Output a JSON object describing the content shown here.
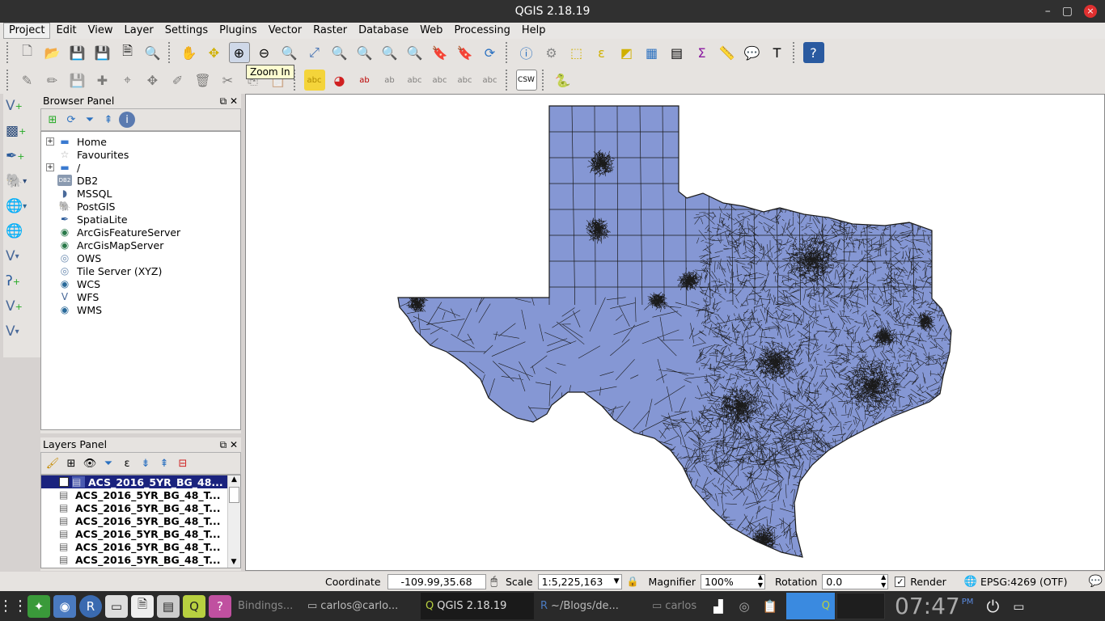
{
  "window": {
    "title": "QGIS 2.18.19",
    "min": "–",
    "max": "▢",
    "close": "×"
  },
  "menu": [
    "Project",
    "Edit",
    "View",
    "Layer",
    "Settings",
    "Plugins",
    "Vector",
    "Raster",
    "Database",
    "Web",
    "Processing",
    "Help"
  ],
  "tooltip": "Zoom In",
  "browser": {
    "title": "Browser Panel",
    "items": [
      {
        "label": "Home",
        "icon": "folder-icon",
        "expand": true
      },
      {
        "label": "Favourites",
        "icon": "star-icon",
        "expand": false
      },
      {
        "label": "/",
        "icon": "folder-icon",
        "expand": true
      },
      {
        "label": "DB2",
        "icon": "db2-icon",
        "expand": false
      },
      {
        "label": "MSSQL",
        "icon": "mssql-icon",
        "expand": false
      },
      {
        "label": "PostGIS",
        "icon": "postgis-icon",
        "expand": false
      },
      {
        "label": "SpatiaLite",
        "icon": "spatialite-icon",
        "expand": false
      },
      {
        "label": "ArcGisFeatureServer",
        "icon": "arcgis-icon",
        "expand": false
      },
      {
        "label": "ArcGisMapServer",
        "icon": "arcgis-icon",
        "expand": false
      },
      {
        "label": "OWS",
        "icon": "globe-icon",
        "expand": false
      },
      {
        "label": "Tile Server (XYZ)",
        "icon": "tile-icon",
        "expand": false
      },
      {
        "label": "WCS",
        "icon": "wcs-icon",
        "expand": false
      },
      {
        "label": "WFS",
        "icon": "wfs-icon",
        "expand": false
      },
      {
        "label": "WMS",
        "icon": "wms-icon",
        "expand": false
      }
    ]
  },
  "layers": {
    "title": "Layers Panel",
    "items": [
      {
        "label": "ACS_2016_5YR_BG_48...",
        "selected": true
      },
      {
        "label": "ACS_2016_5YR_BG_48_T...",
        "selected": false
      },
      {
        "label": "ACS_2016_5YR_BG_48_T...",
        "selected": false
      },
      {
        "label": "ACS_2016_5YR_BG_48_T...",
        "selected": false
      },
      {
        "label": "ACS_2016_5YR_BG_48_T...",
        "selected": false
      },
      {
        "label": "ACS_2016_5YR_BG_48_T...",
        "selected": false
      },
      {
        "label": "ACS_2016_5YR_BG_48_T...",
        "selected": false
      }
    ]
  },
  "map": {
    "fill": "#8597d4",
    "stroke": "#1a1a1a"
  },
  "status": {
    "coordinate_label": "Coordinate",
    "coordinate": "-109.99,35.68",
    "scale_label": "Scale",
    "scale": "1:5,225,163",
    "magnifier_label": "Magnifier",
    "magnifier": "100%",
    "rotation_label": "Rotation",
    "rotation": "0.0",
    "render_label": "Render",
    "crs": "EPSG:4269 (OTF)"
  },
  "taskbar": {
    "tasks": [
      "Bindings...",
      "carlos@carlo...",
      "QGIS 2.18.19",
      "~/Blogs/de...",
      "carlos"
    ],
    "time": "07:47",
    "ampm": "PM"
  }
}
